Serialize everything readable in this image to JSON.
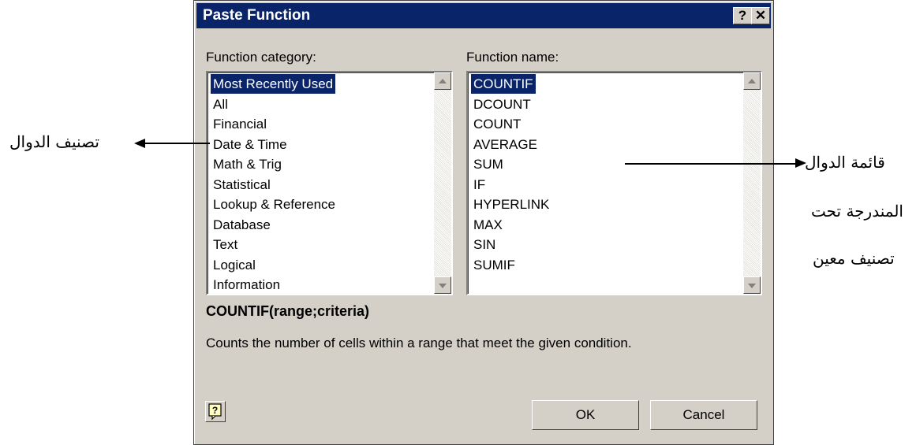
{
  "dialog": {
    "title": "Paste Function",
    "help_button": "?",
    "close_button": "✕",
    "category_label": "Function category:",
    "name_label": "Function name:",
    "categories": [
      "Most Recently Used",
      "All",
      "Financial",
      "Date & Time",
      "Math & Trig",
      "Statistical",
      "Lookup & Reference",
      "Database",
      "Text",
      "Logical",
      "Information"
    ],
    "functions": [
      "COUNTIF",
      "DCOUNT",
      "COUNT",
      "AVERAGE",
      "SUM",
      "IF",
      "HYPERLINK",
      "MAX",
      "SIN",
      "SUMIF"
    ],
    "syntax": "COUNTIF(range;criteria)",
    "description": "Counts the number of cells within a range that meet the given condition.",
    "ok": "OK",
    "cancel": "Cancel"
  },
  "annotations": {
    "left": "تصنيف الدوال",
    "right1": "قائمة الدوال",
    "right2": "المندرجة تحت",
    "right3": "تصنيف معين"
  }
}
